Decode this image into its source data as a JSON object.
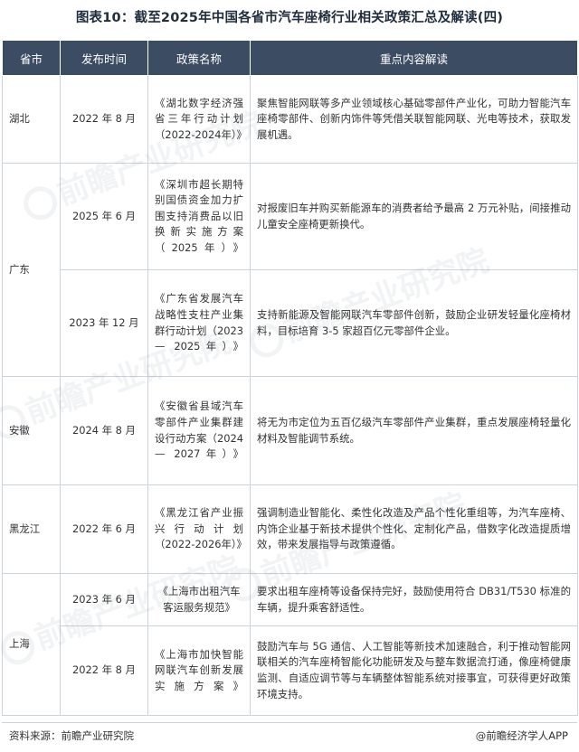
{
  "title": "图表10：截至2025年中国各省市汽车座椅行业相关政策汇总及解读(四)",
  "table": {
    "headers": [
      "省市",
      "发布时间",
      "政策名称",
      "重点内容解读"
    ],
    "rows": [
      {
        "province": "湖北",
        "date": "2022 年 8 月",
        "policy": "《湖北数字经济强省三年行动计划（2022-2024年）》",
        "content": "聚焦智能网联等多产业领域核心基础零部件产业化，可助力智能汽车座椅零部件、创新内饰件等凭借关联智能网联、光电等技术，获取发展机遇。"
      },
      {
        "province": "广东",
        "date": "2025 年 6 月",
        "policy": "《深圳市超长期特别国债资金加力扩围支持消费品以旧换新实施方案（2025年）》",
        "content": "对报废旧车并购买新能源车的消费者给予最高 2 万元补贴，间接推动儿童安全座椅更新换代。"
      },
      {
        "province": "",
        "date": "2023 年 12 月",
        "policy": "《广东省发展汽车战略性支柱产业集群行动计划（2023 — 2025年）》",
        "content": "支持新能源及智能网联汽车零部件创新，鼓励企业研发轻量化座椅材料，目标培育 3-5 家超百亿元零部件企业。"
      },
      {
        "province": "安徽",
        "date": "2024 年 8 月",
        "policy": "《安徽省县域汽车零部件产业集群建设行动方案（2024 — 2027年）》",
        "content": "将无为市定位为五百亿级汽车零部件产业集群，重点发展座椅轻量化材料及智能调节系统。"
      },
      {
        "province": "黑龙江",
        "date": "2022 年 6 月",
        "policy": "《黑龙江省产业振兴行动计划（2022-2026年）》",
        "content": "强调制造业智能化、柔性化改造及产品个性化重组等，为汽车座椅、内饰企业基于新技术提供个性化、定制化产品，借数字化改造提质增效，带来发展指导与政策遵循。"
      },
      {
        "province": "上海",
        "date": "2023 年 6 月",
        "policy": "《上海市出租汽车客运服务规范》",
        "content": "要求出租车座椅等设备保持完好，鼓励使用符合 DB31/T530 标准的车辆，提升乘客舒适性。"
      },
      {
        "province": "",
        "date": "2022 年 8 月",
        "policy": "《上海市加快智能网联汽车创新发展实施方案》",
        "content": "鼓励汽车与 5G 通信、人工智能等新技术加速融合，利于推动智能网联相关的汽车座椅智能化功能研发及与整车数据流打通，像座椅健康监测、自适应调节等与车辆整体智能系统对接事宜，可获得更好政策环境支持。"
      }
    ]
  },
  "watermark": "前瞻产业研究院",
  "footer": {
    "source": "资料来源：前瞻产业研究院",
    "brand": "@前瞻经济学人APP"
  }
}
